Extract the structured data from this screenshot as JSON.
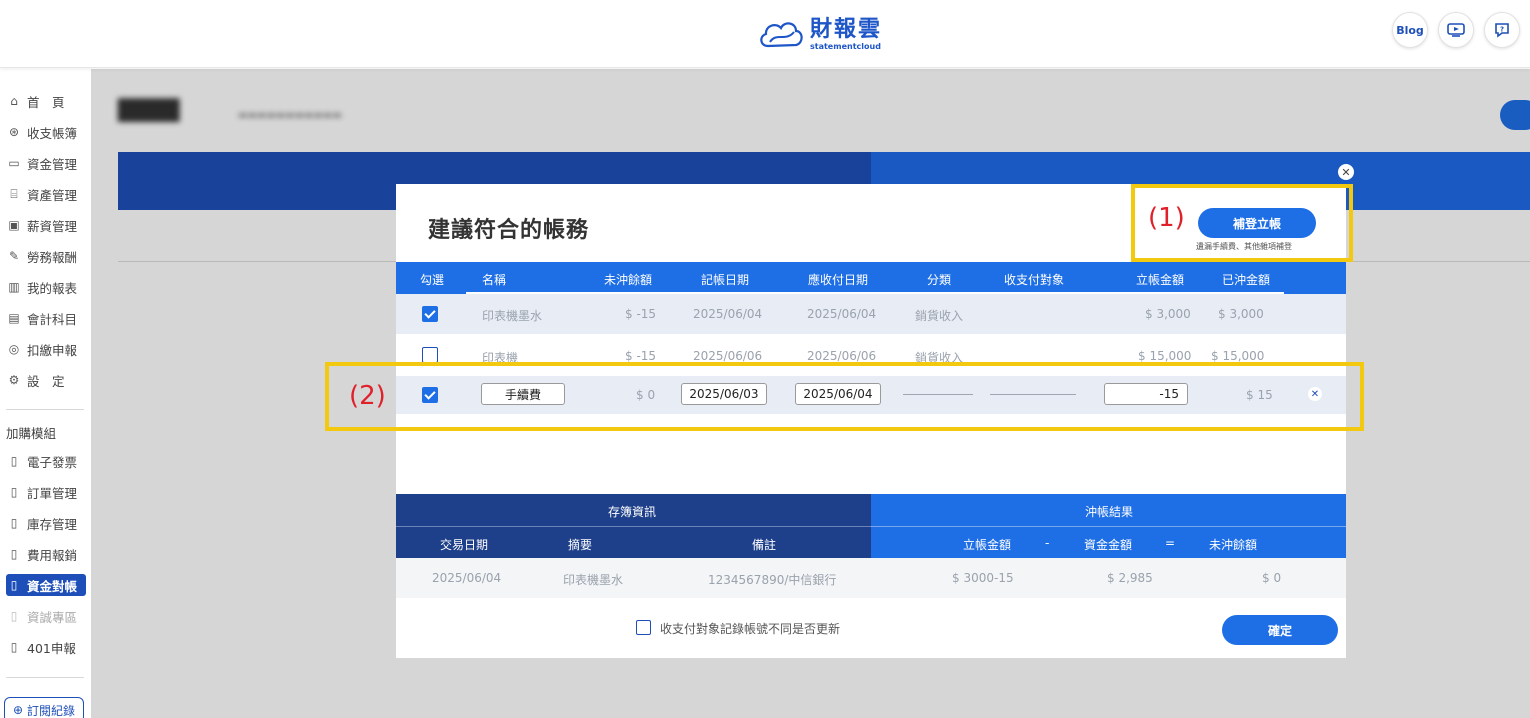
{
  "header": {
    "logo_cn": "財報雲",
    "logo_en": "statementcloud",
    "blog_label": "Blog"
  },
  "sidebar": {
    "items": [
      {
        "label": "首　頁",
        "icon": "home-icon"
      },
      {
        "label": "收支帳簿",
        "icon": "coin-icon"
      },
      {
        "label": "資金管理",
        "icon": "wallet-icon"
      },
      {
        "label": "資產管理",
        "icon": "bank-icon"
      },
      {
        "label": "薪資管理",
        "icon": "payroll-icon"
      },
      {
        "label": "勞務報酬",
        "icon": "labor-icon"
      },
      {
        "label": "我的報表",
        "icon": "chart-icon"
      },
      {
        "label": "會計科目",
        "icon": "ledger-icon"
      },
      {
        "label": "扣繳申報",
        "icon": "tax-icon"
      },
      {
        "label": "設　定",
        "icon": "settings-icon"
      }
    ],
    "addon_heading": "加購模組",
    "addons": [
      {
        "label": "電子發票",
        "state": "normal"
      },
      {
        "label": "訂單管理",
        "state": "normal"
      },
      {
        "label": "庫存管理",
        "state": "normal"
      },
      {
        "label": "費用報銷",
        "state": "normal"
      },
      {
        "label": "資金對帳",
        "state": "active"
      },
      {
        "label": "資誠專區",
        "state": "disabled"
      },
      {
        "label": "401申報",
        "state": "normal"
      }
    ],
    "subscription_label": "訂閱紀錄"
  },
  "modal": {
    "title": "建議符合的帳務",
    "supplement_button": "補登立帳",
    "supplement_note": "遺漏手續費、其他雜項補登",
    "columns": [
      "勾選",
      "名稱",
      "未沖餘額",
      "記帳日期",
      "應收付日期",
      "分類",
      "收支付對象",
      "立帳金額",
      "已沖金額"
    ],
    "rows": [
      {
        "checked": true,
        "name": "印表機墨水",
        "balance": "$ -15",
        "record_date": "2025/06/04",
        "due_date": "2025/06/04",
        "category": "銷貨收入",
        "counterparty": "",
        "amount": "$ 3,000",
        "settled": "$ 3,000"
      },
      {
        "checked": false,
        "name": "印表機",
        "balance": "$ -15",
        "record_date": "2025/06/06",
        "due_date": "2025/06/06",
        "category": "銷貨收入",
        "counterparty": "",
        "amount": "$ 15,000",
        "settled": "$ 15,000"
      }
    ],
    "edit_row": {
      "checked": true,
      "name": "手續費",
      "balance": "$ 0",
      "record_date": "2025/06/03",
      "due_date": "2025/06/04",
      "amount": "-15",
      "settled": "$ 15"
    },
    "deposit_section": {
      "title": "存簿資訊",
      "columns": [
        "交易日期",
        "摘要",
        "備註"
      ]
    },
    "result_section": {
      "title": "沖帳結果",
      "columns": [
        "立帳金額",
        "-",
        "資金金額",
        "=",
        "未沖餘額"
      ]
    },
    "result_row": {
      "date": "2025/06/04",
      "summary": "印表機墨水",
      "note": "1234567890/中信銀行",
      "amount": "$ 3000-15",
      "fund": "$ 2,985",
      "remaining": "$ 0"
    },
    "update_checkbox_label": "收支付對象記錄帳號不同是否更新",
    "confirm_button": "確定"
  },
  "annotations": {
    "label1": "(1)",
    "label2": "(2)",
    "color": "#f3c90f",
    "label_color": "#e0202a"
  }
}
